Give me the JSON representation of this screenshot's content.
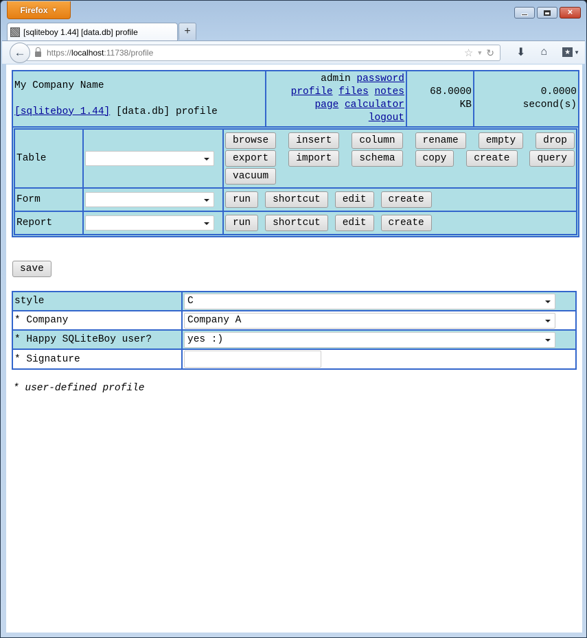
{
  "browser": {
    "app_button": "Firefox",
    "tab_title": "[sqliteboy 1.44] [data.db] profile",
    "url_scheme": "https://",
    "url_host": "localhost",
    "url_rest": ":11738/profile"
  },
  "header": {
    "company": "My Company Name",
    "app_link": "[sqliteboy 1.44]",
    "db_label": "[data.db] profile",
    "user": "admin",
    "links": {
      "password": "password",
      "profile": "profile",
      "files": "files",
      "notes": "notes",
      "page": "page",
      "calculator": "calculator",
      "logout": "logout"
    },
    "size_value": "68.0000",
    "size_unit": "KB",
    "time_value": "0.0000",
    "time_unit": "second(s)"
  },
  "operations": {
    "table": {
      "label": "Table",
      "selected": "",
      "buttons_row1": [
        "browse",
        "insert",
        "column",
        "rename",
        "empty",
        "drop"
      ],
      "buttons_row2": [
        "export",
        "import",
        "schema",
        "copy",
        "create",
        "query"
      ],
      "buttons_row3": [
        "vacuum"
      ]
    },
    "form": {
      "label": "Form",
      "selected": "",
      "buttons": [
        "run",
        "shortcut",
        "edit",
        "create"
      ]
    },
    "report": {
      "label": "Report",
      "selected": "",
      "buttons": [
        "run",
        "shortcut",
        "edit",
        "create"
      ]
    }
  },
  "save_label": "save",
  "profile_form": {
    "rows": [
      {
        "label": "style",
        "type": "select",
        "value": "C"
      },
      {
        "label": "* Company",
        "type": "select",
        "value": "Company A"
      },
      {
        "label": "* Happy SQLiteBoy user?",
        "type": "select",
        "value": "yes :)"
      },
      {
        "label": "* Signature",
        "type": "text",
        "value": ""
      }
    ]
  },
  "footnote": "* user-defined profile",
  "colors": {
    "cell_bg": "#b0dfe5",
    "border": "#3366cc",
    "link": "#000099"
  }
}
